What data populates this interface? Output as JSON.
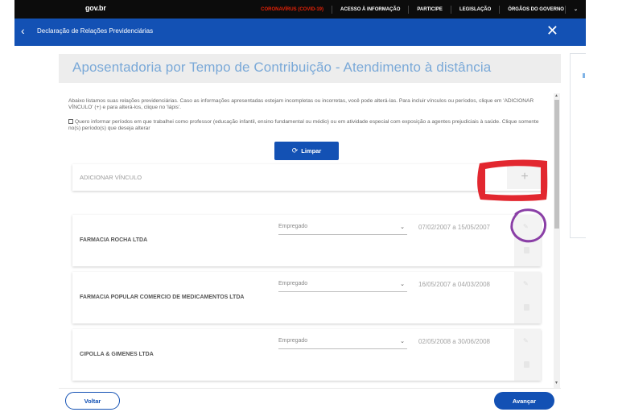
{
  "govbar": {
    "logo": "gov.br",
    "links": [
      {
        "label": "CORONAVÍRUS (COVID-19)"
      },
      {
        "label": "ACESSO À INFORMAÇÃO"
      },
      {
        "label": "PARTICIPE"
      },
      {
        "label": "LEGISLAÇÃO"
      },
      {
        "label": "ÓRGÃOS DO GOVERNO"
      }
    ],
    "covid_color": "#e52207"
  },
  "header": {
    "title": "Declaração de Relações Previdenciárias",
    "back_icon": "chevron-left-icon",
    "close_icon": "close-icon"
  },
  "main": {
    "title": "Aposentadoria por Tempo de Contribuição - Atendimento à distância",
    "intro": "Abaixo listamos suas relações previdenciárias. Caso as informações apresentadas estejam incompletas ou incorretas, você pode alterá-las. Para incluir vínculos ou períodos, clique em 'ADICIONAR VÍNCULO' (+) e para alterá-los, clique no 'lápis'.",
    "checkbox_label": "Quero informar períodos em que trabalhei como professor (educação infantil, ensino fundamental ou médio) ou em atividade especial com exposição a agentes prejudiciais à saúde. Clique somente no(s) período(s) que deseja alterar",
    "limpar_label": "Limpar",
    "add_vinculo_label": "ADICIONAR VÍNCULO",
    "add_icon": "+"
  },
  "vinculos": [
    {
      "name": "FARMACIA ROCHA LTDA",
      "type": "Empregado",
      "period": "07/02/2007 a 15/05/2007"
    },
    {
      "name": "FARMACIA POPULAR COMERCIO DE MEDICAMENTOS LTDA",
      "type": "Empregado",
      "period": "16/05/2007 a 04/03/2008"
    },
    {
      "name": "CIPOLLA & GIMENES LTDA",
      "type": "Empregado",
      "period": "02/05/2008 a 30/06/2008"
    }
  ],
  "footer": {
    "voltar_label": "Voltar",
    "avancar_label": "Avançar"
  },
  "colors": {
    "primary": "#1351b4",
    "title_text": "#7aa9d8",
    "annotation_red": "#e01b24",
    "annotation_purple": "#8a3fa6"
  }
}
